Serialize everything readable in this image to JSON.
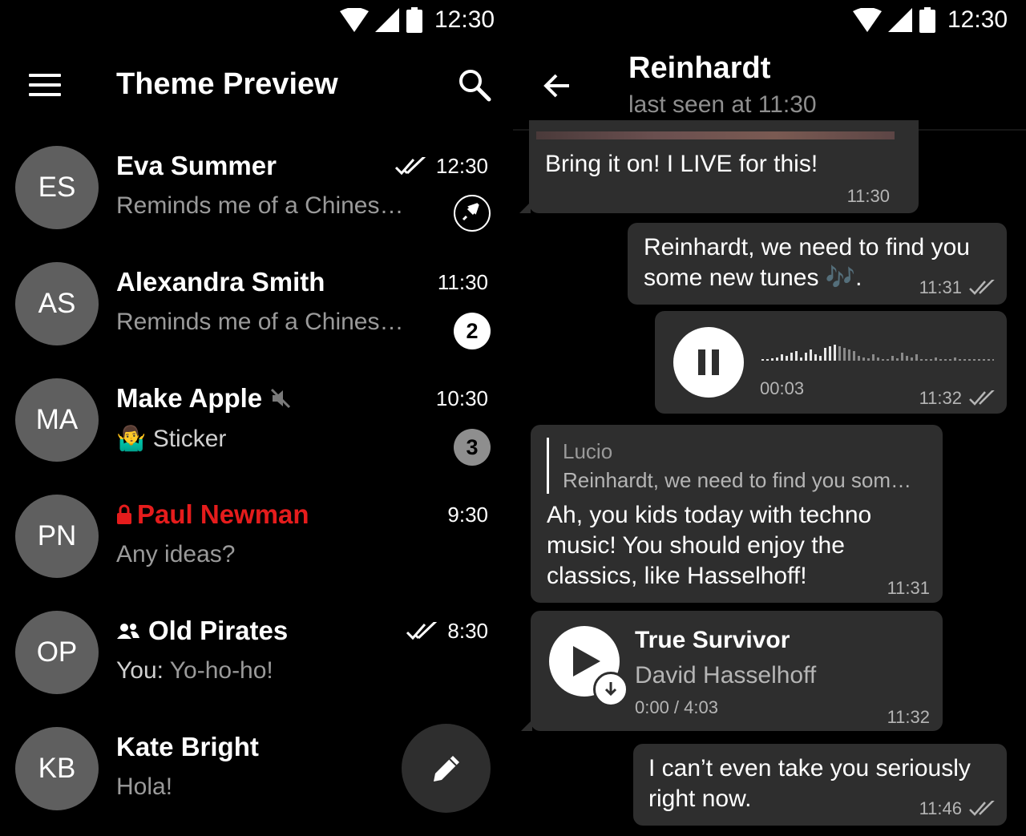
{
  "left": {
    "status": {
      "time": "12:30",
      "icons": [
        "wifi-icon",
        "cell-signal-icon",
        "battery-icon"
      ]
    },
    "header": {
      "title": "Theme Preview",
      "menu_icon": "menu-icon",
      "search_icon": "search-icon"
    },
    "chats": [
      {
        "initials": "ES",
        "name": "Eva Summer",
        "preview": "Reminds me of a Chines…",
        "time": "12:30",
        "read_ticks": true,
        "pinned": true
      },
      {
        "initials": "AS",
        "name": "Alexandra Smith",
        "preview": "Reminds me of a Chines…",
        "time": "11:30",
        "unread": "2",
        "badge_style": "white"
      },
      {
        "initials": "MA",
        "name": "Make Apple",
        "muted": true,
        "preview_emoji": "🤷‍♂️",
        "preview": "Sticker",
        "time": "10:30",
        "unread": "3",
        "badge_style": "grey"
      },
      {
        "initials": "PN",
        "name": "Paul Newman",
        "secret": true,
        "name_color": "#e51c1c",
        "preview": "Any ideas?",
        "time": "9:30"
      },
      {
        "initials": "OP",
        "name": "Old Pirates",
        "group": true,
        "preview_sender": "You:",
        "preview": "Yo-ho-ho!",
        "time": "8:30",
        "read_ticks": true
      },
      {
        "initials": "KB",
        "name": "Kate Bright",
        "preview": "Hola!"
      }
    ],
    "fab_icon": "pencil-icon"
  },
  "right": {
    "status": {
      "time": "12:30"
    },
    "header": {
      "name": "Reinhardt",
      "status": "last seen at 11:30",
      "back_icon": "back-arrow-icon"
    },
    "messages": [
      {
        "type": "in",
        "text": "Bring it on! I LIVE for this!",
        "time": "11:30"
      },
      {
        "type": "out",
        "text_line1": "Reinhardt, we need to find you",
        "text_line2": "some new tunes 🎶.",
        "time": "11:31"
      },
      {
        "type": "out-voice",
        "duration": "00:03",
        "time": "11:32"
      },
      {
        "type": "in-reply",
        "reply_name": "Lucio",
        "reply_text": "Reinhardt, we need to find you som…",
        "line1": "Ah, you kids today with techno",
        "line2": "music! You should enjoy the",
        "line3": "classics, like Hasselhoff!",
        "time": "11:31"
      },
      {
        "type": "in-audio",
        "title": "True Survivor",
        "artist": "David Hasselhoff",
        "progress": "0:00 / 4:03",
        "time": "11:32"
      },
      {
        "type": "out",
        "text_line1": "I can’t even take you seriously",
        "text_line2": "right now.",
        "time": "11:46"
      }
    ]
  },
  "colors": {
    "background": "#000000",
    "bubble": "#2e2e2e",
    "avatar": "#5f5f5f",
    "secret_red": "#e51c1c",
    "muted_text": "#9a9a9a"
  }
}
